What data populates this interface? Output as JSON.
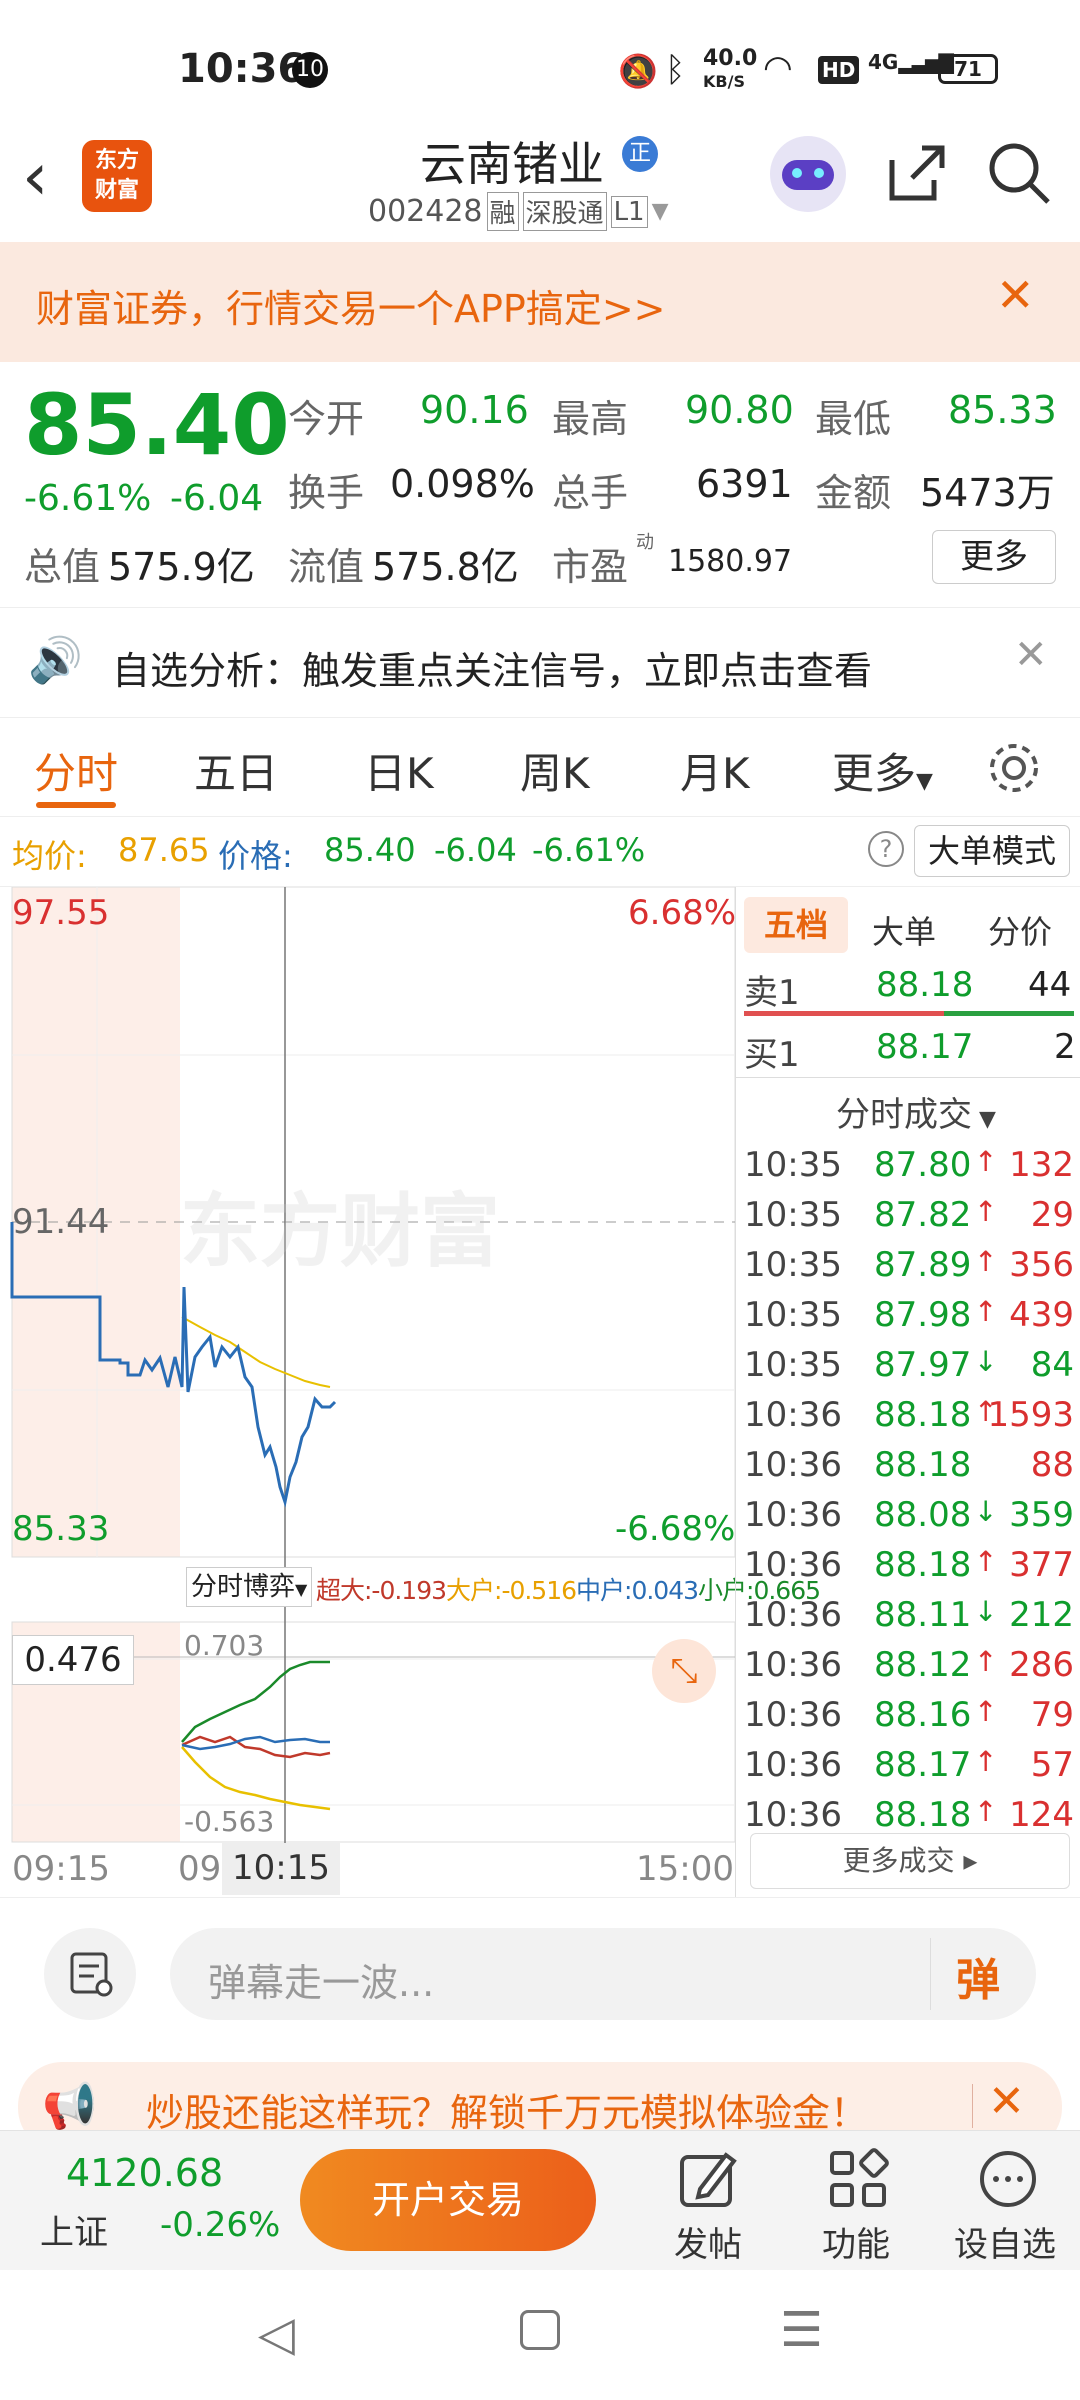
{
  "status_bar": {
    "time": "10:36",
    "notif_count": "10",
    "net_speed": "40.0",
    "net_unit": "KB/S",
    "hd": "HD",
    "signal": "4G",
    "battery": "71"
  },
  "header": {
    "logo_line1": "东方",
    "logo_line2": "财富",
    "title": "云南锗业",
    "badge": "正",
    "code": "002428",
    "tag1": "融",
    "tag2": "深股通",
    "tag3": "L1"
  },
  "banner": {
    "text": "财富证券，行情交易一个APP搞定>>"
  },
  "quote": {
    "price": "85.40",
    "change_pct": "-6.61%",
    "change": "-6.04",
    "open_label": "今开",
    "open": "90.16",
    "high_label": "最高",
    "high": "90.80",
    "low_label": "最低",
    "low": "85.33",
    "turnover_label": "换手",
    "turnover": "0.098%",
    "volume_label": "总手",
    "volume": "6391",
    "amount_label": "金额",
    "amount": "5473万",
    "mcap_label": "总值",
    "mcap": "575.9亿",
    "float_label": "流值",
    "float": "575.8亿",
    "pe_label": "市盈",
    "pe_sup": "动",
    "pe": "1580.97",
    "more": "更多"
  },
  "alert": {
    "text": "自选分析：触发重点关注信号，立即点击查看"
  },
  "tabs": [
    "分时",
    "五日",
    "日K",
    "周K",
    "月K",
    "更多"
  ],
  "infobar": {
    "avg_label": "均价:",
    "avg": "87.65",
    "price_label": "价格:",
    "price": "85.40",
    "change": "-6.04",
    "change_pct": "-6.61%",
    "mode": "大单模式"
  },
  "chart": {
    "top_price": "97.55",
    "top_pct": "6.68%",
    "mid_price": "91.44",
    "bottom_price": "85.33",
    "bottom_pct": "-6.68%",
    "watermark": "东方财富",
    "flow_selector": "分时博弈",
    "flow_super": "超大:-0.193",
    "flow_large": "大户:-0.516",
    "flow_mid": "中户:0.043",
    "flow_small": "小户:0.665",
    "flow_value": "0.476",
    "flow_top": "0.703",
    "flow_bottom": "-0.563",
    "time_start": "09:15",
    "time_cut": "09",
    "time_cursor": "10:15",
    "time_end": "15:00"
  },
  "side": {
    "tabs": [
      "五档",
      "大单",
      "分价"
    ],
    "sell1_label": "卖1",
    "sell1_price": "88.18",
    "sell1_vol": "44",
    "buy1_label": "买1",
    "buy1_price": "88.17",
    "buy1_vol": "2",
    "trades_title": "分时成交",
    "trades": [
      {
        "t": "10:35",
        "p": "87.80",
        "d": "↑",
        "v": "132",
        "c": "red"
      },
      {
        "t": "10:35",
        "p": "87.82",
        "d": "↑",
        "v": "29",
        "c": "red"
      },
      {
        "t": "10:35",
        "p": "87.89",
        "d": "↑",
        "v": "356",
        "c": "red"
      },
      {
        "t": "10:35",
        "p": "87.98",
        "d": "↑",
        "v": "439",
        "c": "red"
      },
      {
        "t": "10:35",
        "p": "87.97",
        "d": "↓",
        "v": "84",
        "c": "green"
      },
      {
        "t": "10:36",
        "p": "88.18",
        "d": "↑",
        "v": "1593",
        "c": "red"
      },
      {
        "t": "10:36",
        "p": "88.18",
        "d": "",
        "v": "88",
        "c": "red"
      },
      {
        "t": "10:36",
        "p": "88.08",
        "d": "↓",
        "v": "359",
        "c": "green"
      },
      {
        "t": "10:36",
        "p": "88.18",
        "d": "↑",
        "v": "377",
        "c": "red"
      },
      {
        "t": "10:36",
        "p": "88.11",
        "d": "↓",
        "v": "212",
        "c": "green"
      },
      {
        "t": "10:36",
        "p": "88.12",
        "d": "↑",
        "v": "286",
        "c": "red"
      },
      {
        "t": "10:36",
        "p": "88.16",
        "d": "↑",
        "v": "79",
        "c": "red"
      },
      {
        "t": "10:36",
        "p": "88.17",
        "d": "↑",
        "v": "57",
        "c": "red"
      },
      {
        "t": "10:36",
        "p": "88.18",
        "d": "↑",
        "v": "124",
        "c": "red"
      }
    ],
    "more_trades": "更多成交"
  },
  "danmu": {
    "placeholder": "弹幕走一波...",
    "button": "弹"
  },
  "promo": {
    "text": "炒股还能这样玩？解锁千万元模拟体验金！"
  },
  "bottom": {
    "index_value": "4120.68",
    "index_name": "上证",
    "index_change": "-0.26%",
    "open_account": "开户交易",
    "post": "发帖",
    "func": "功能",
    "watch": "设自选"
  },
  "colors": {
    "up": "#d93030",
    "down": "#0f9d2c",
    "accent": "#e8650e"
  }
}
